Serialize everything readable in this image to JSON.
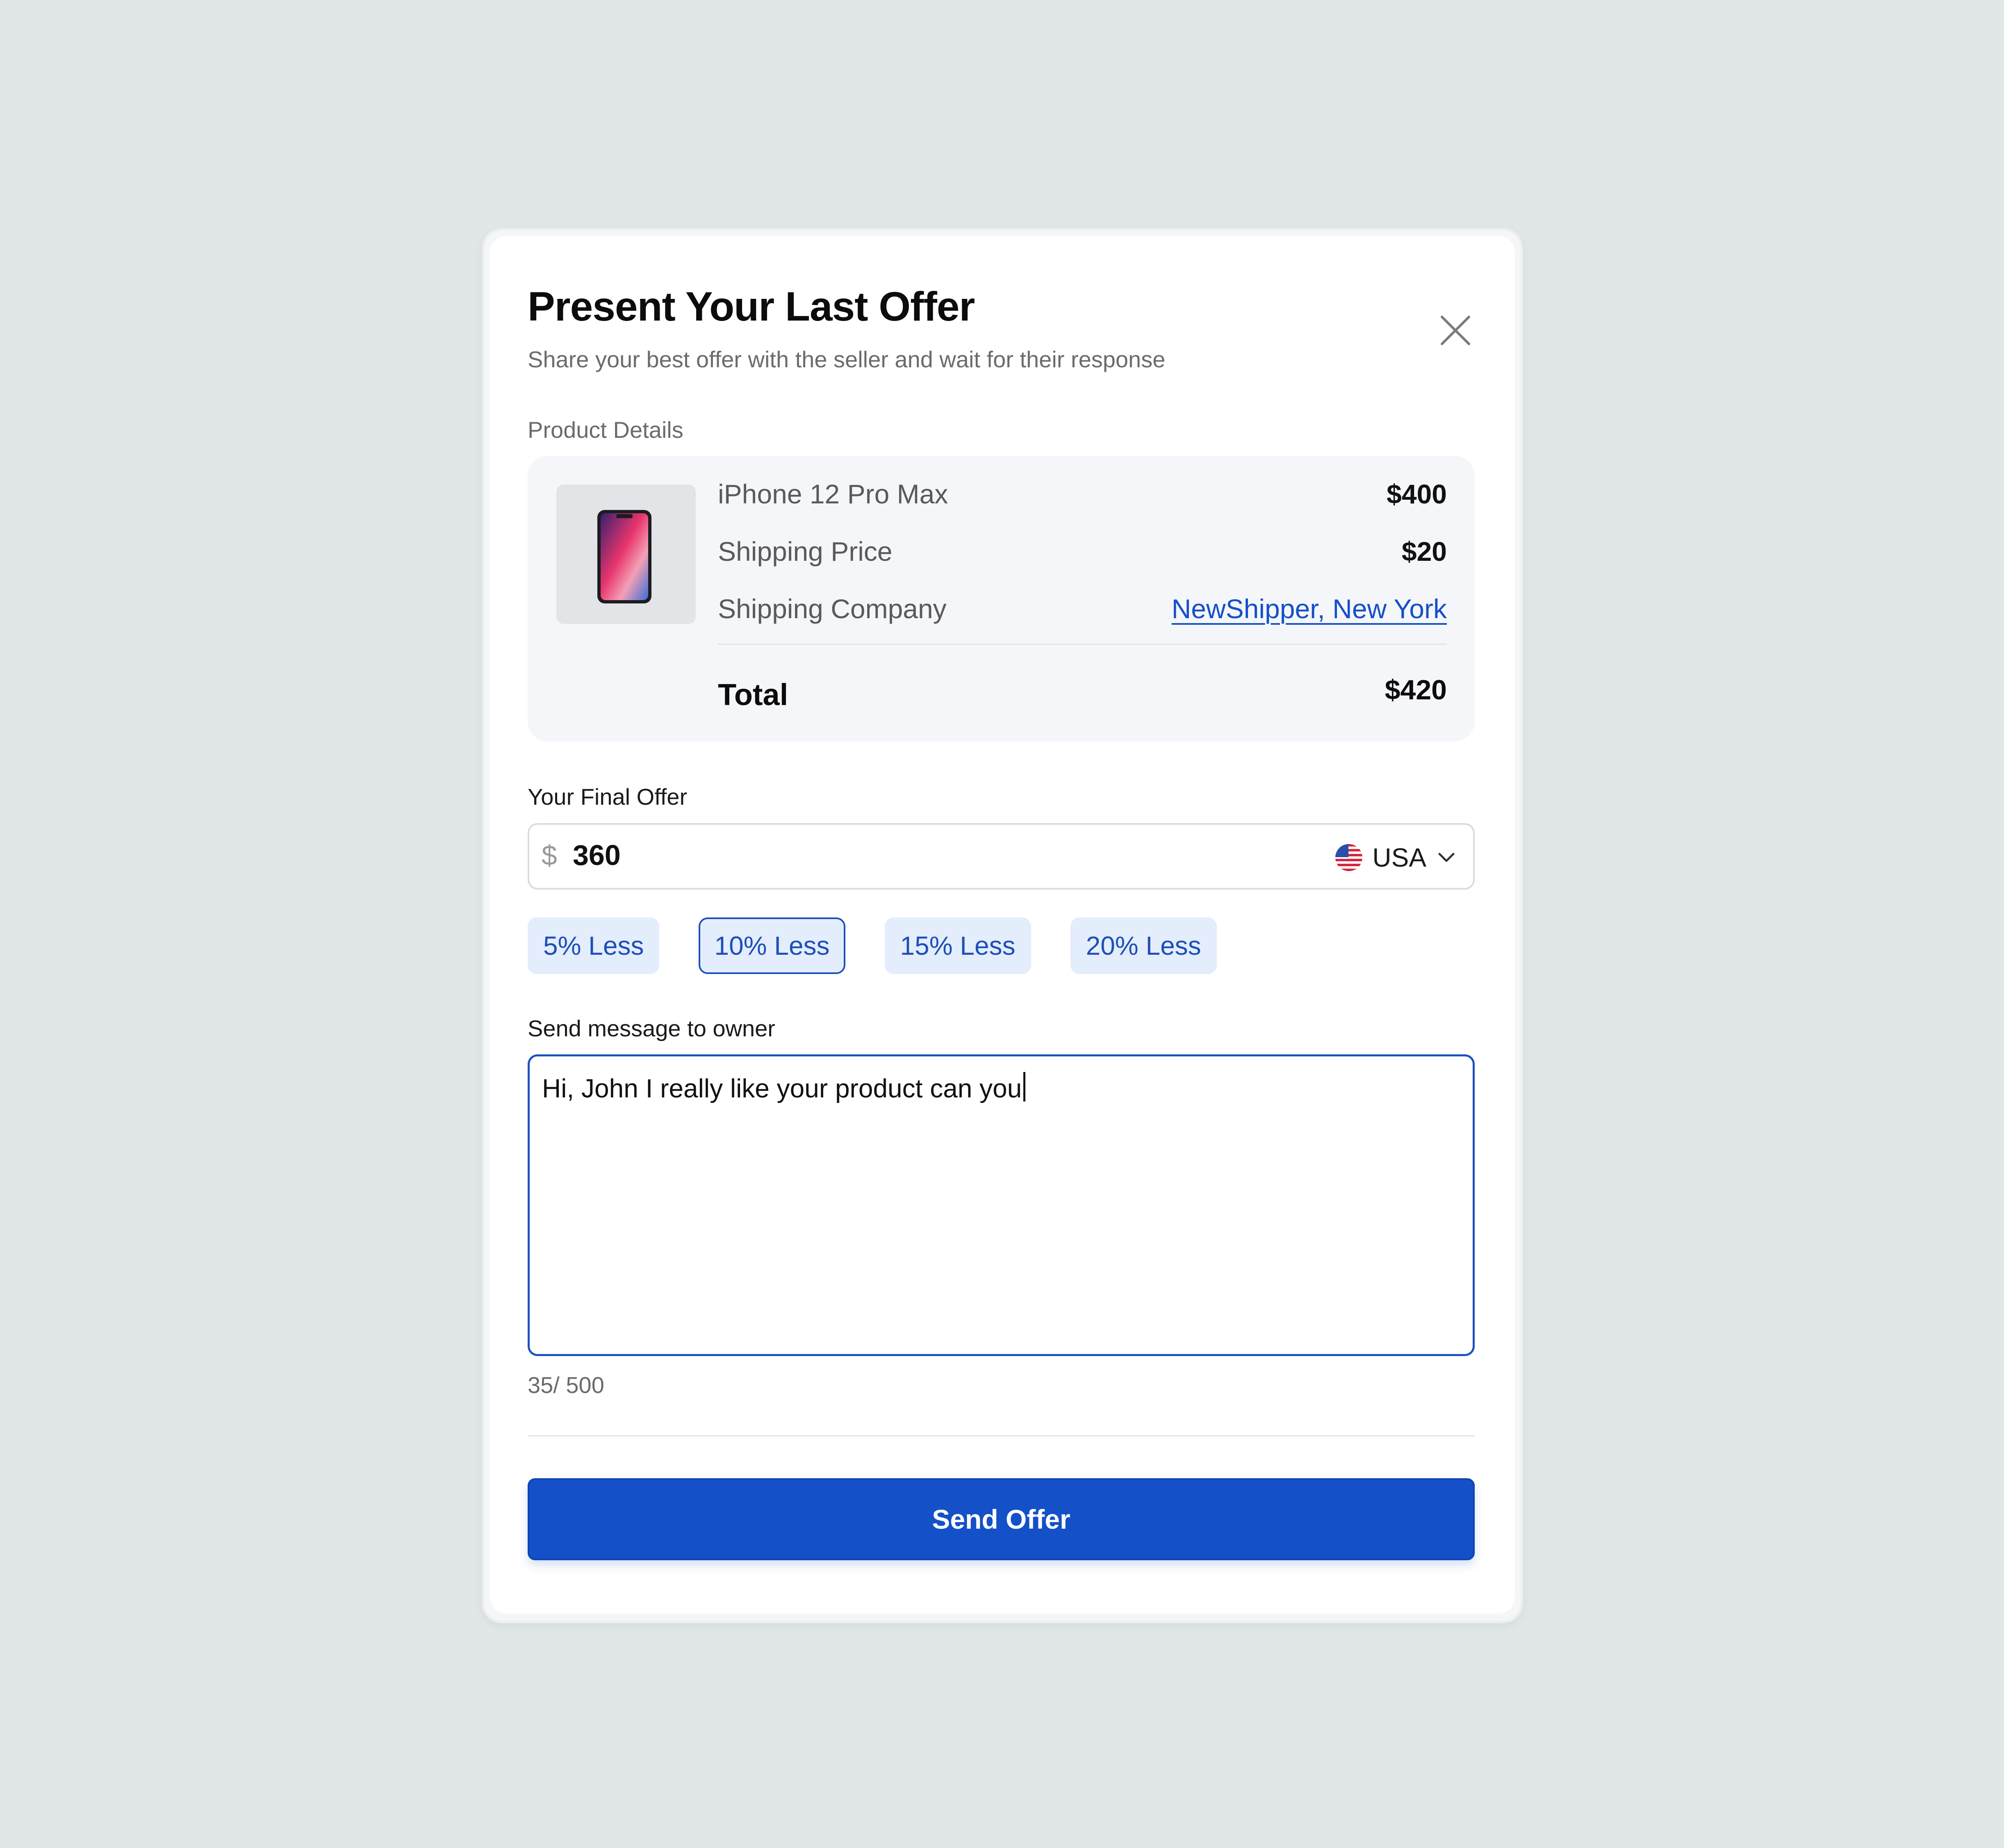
{
  "modal": {
    "title": "Present Your Last Offer",
    "subtitle": "Share your best offer with the seller and wait for their response"
  },
  "product": {
    "section_label": "Product Details",
    "name": "iPhone 12 Pro Max",
    "price": "$400",
    "shipping_price_label": "Shipping Price",
    "shipping_price": "$20",
    "shipping_company_label": "Shipping Company",
    "shipping_company": "NewShipper, New York",
    "total_label": "Total",
    "total": "$420"
  },
  "offer": {
    "label": "Your Final Offer",
    "currency_symbol": "$",
    "value": "360",
    "country": "USA",
    "country_icon": "us-flag-icon"
  },
  "discount_chips": [
    {
      "label": "5% Less",
      "selected": false
    },
    {
      "label": "10% Less",
      "selected": true
    },
    {
      "label": "15% Less",
      "selected": false
    },
    {
      "label": "20% Less",
      "selected": false
    }
  ],
  "message": {
    "label": "Send message to owner",
    "value": "Hi, John I really like your product can you",
    "counter": "35/ 500"
  },
  "actions": {
    "send_label": "Send Offer"
  },
  "colors": {
    "accent": "#1450c8",
    "chip_bg": "#e3edfb",
    "background": "#e1e6e9"
  }
}
